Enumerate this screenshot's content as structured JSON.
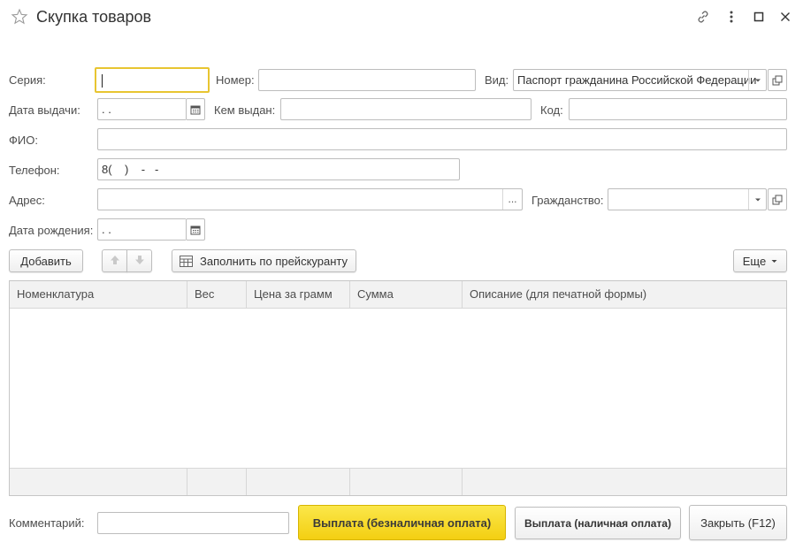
{
  "window": {
    "title": "Скупка товаров"
  },
  "form": {
    "series_label": "Серия:",
    "series_value": "",
    "number_label": "Номер:",
    "number_value": "",
    "type_label": "Вид:",
    "type_value": "Паспорт гражданина Российской Федерации",
    "issue_date_label": "Дата выдачи:",
    "issue_date_value": " .  .",
    "issued_by_label": "Кем выдан:",
    "issued_by_value": "",
    "code_label": "Код:",
    "code_value": "",
    "fio_label": "ФИО:",
    "fio_value": "",
    "phone_label": "Телефон:",
    "phone_value": "8(    )    -   -",
    "address_label": "Адрес:",
    "address_value": "",
    "address_more": "...",
    "citizenship_label": "Гражданство:",
    "citizenship_value": "",
    "birth_date_label": "Дата рождения:",
    "birth_date_value": " .  ."
  },
  "toolbar": {
    "add_label": "Добавить",
    "fill_label": "Заполнить по прейскуранту",
    "more_label": "Еще"
  },
  "table": {
    "columns": [
      "Номенклатура",
      "Вес",
      "Цена за грамм",
      "Сумма",
      "Описание (для печатной формы)"
    ],
    "rows": []
  },
  "footer": {
    "comment_label": "Комментарий:",
    "comment_value": "",
    "pay_cashless_label": "Выплата (безналичная оплата)",
    "pay_cash_label": "Выплата (наличная оплата)",
    "close_label": "Закрыть (F12)"
  },
  "colors": {
    "accent_yellow": "#f5d423",
    "focus_border": "#e8c531",
    "border": "#bdbdbd"
  },
  "icons": [
    "star-icon",
    "link-icon",
    "more-vertical-icon",
    "maximize-icon",
    "close-icon",
    "calendar-icon",
    "dropdown-arrow-icon",
    "open-form-icon",
    "arrow-up-icon",
    "arrow-down-icon",
    "table-fill-icon"
  ]
}
